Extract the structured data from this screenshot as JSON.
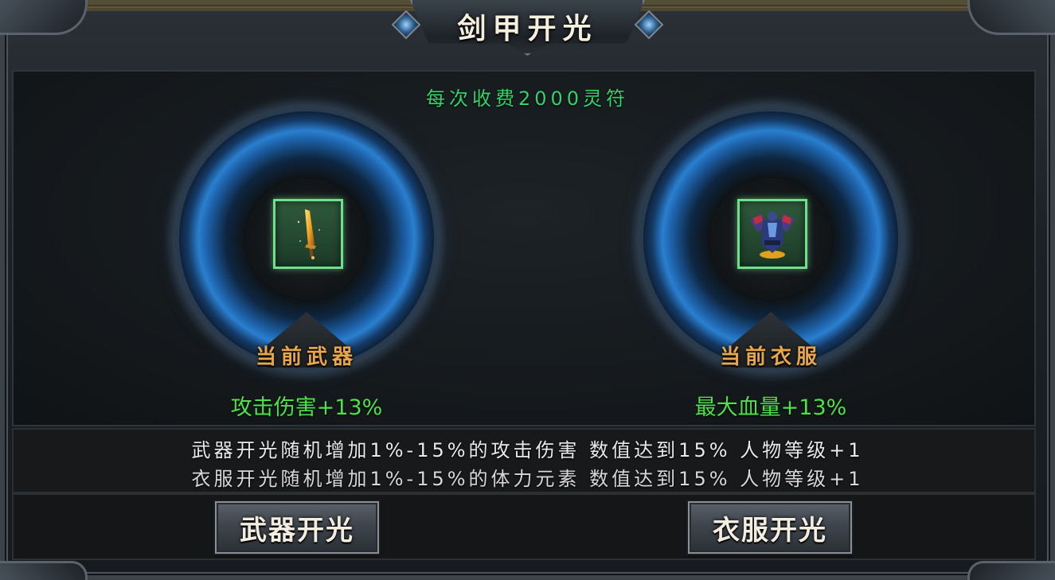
{
  "window": {
    "title": "剑甲开光"
  },
  "fee_text": "每次收费2000灵符",
  "weapon": {
    "label": "当前武器",
    "bonus": "攻击伤害+13%",
    "icon": "sword-icon",
    "slot_color": "#6fe08a"
  },
  "armor": {
    "label": "当前衣服",
    "bonus": "最大血量+13%",
    "icon": "armor-icon",
    "slot_color": "#6fe08a"
  },
  "description": {
    "line1": "武器开光随机增加1%-15%的攻击伤害 数值达到15% 人物等级+1",
    "line2": "衣服开光随机增加1%-15%的体力元素 数值达到15% 人物等级+1"
  },
  "buttons": {
    "weapon_label": "武器开光",
    "armor_label": "衣服开光"
  },
  "colors": {
    "fee_text": "#33d36b",
    "label_text": "#e7a64a",
    "bonus_text": "#4ee14b",
    "ring_glow": "#2a7fd0"
  }
}
